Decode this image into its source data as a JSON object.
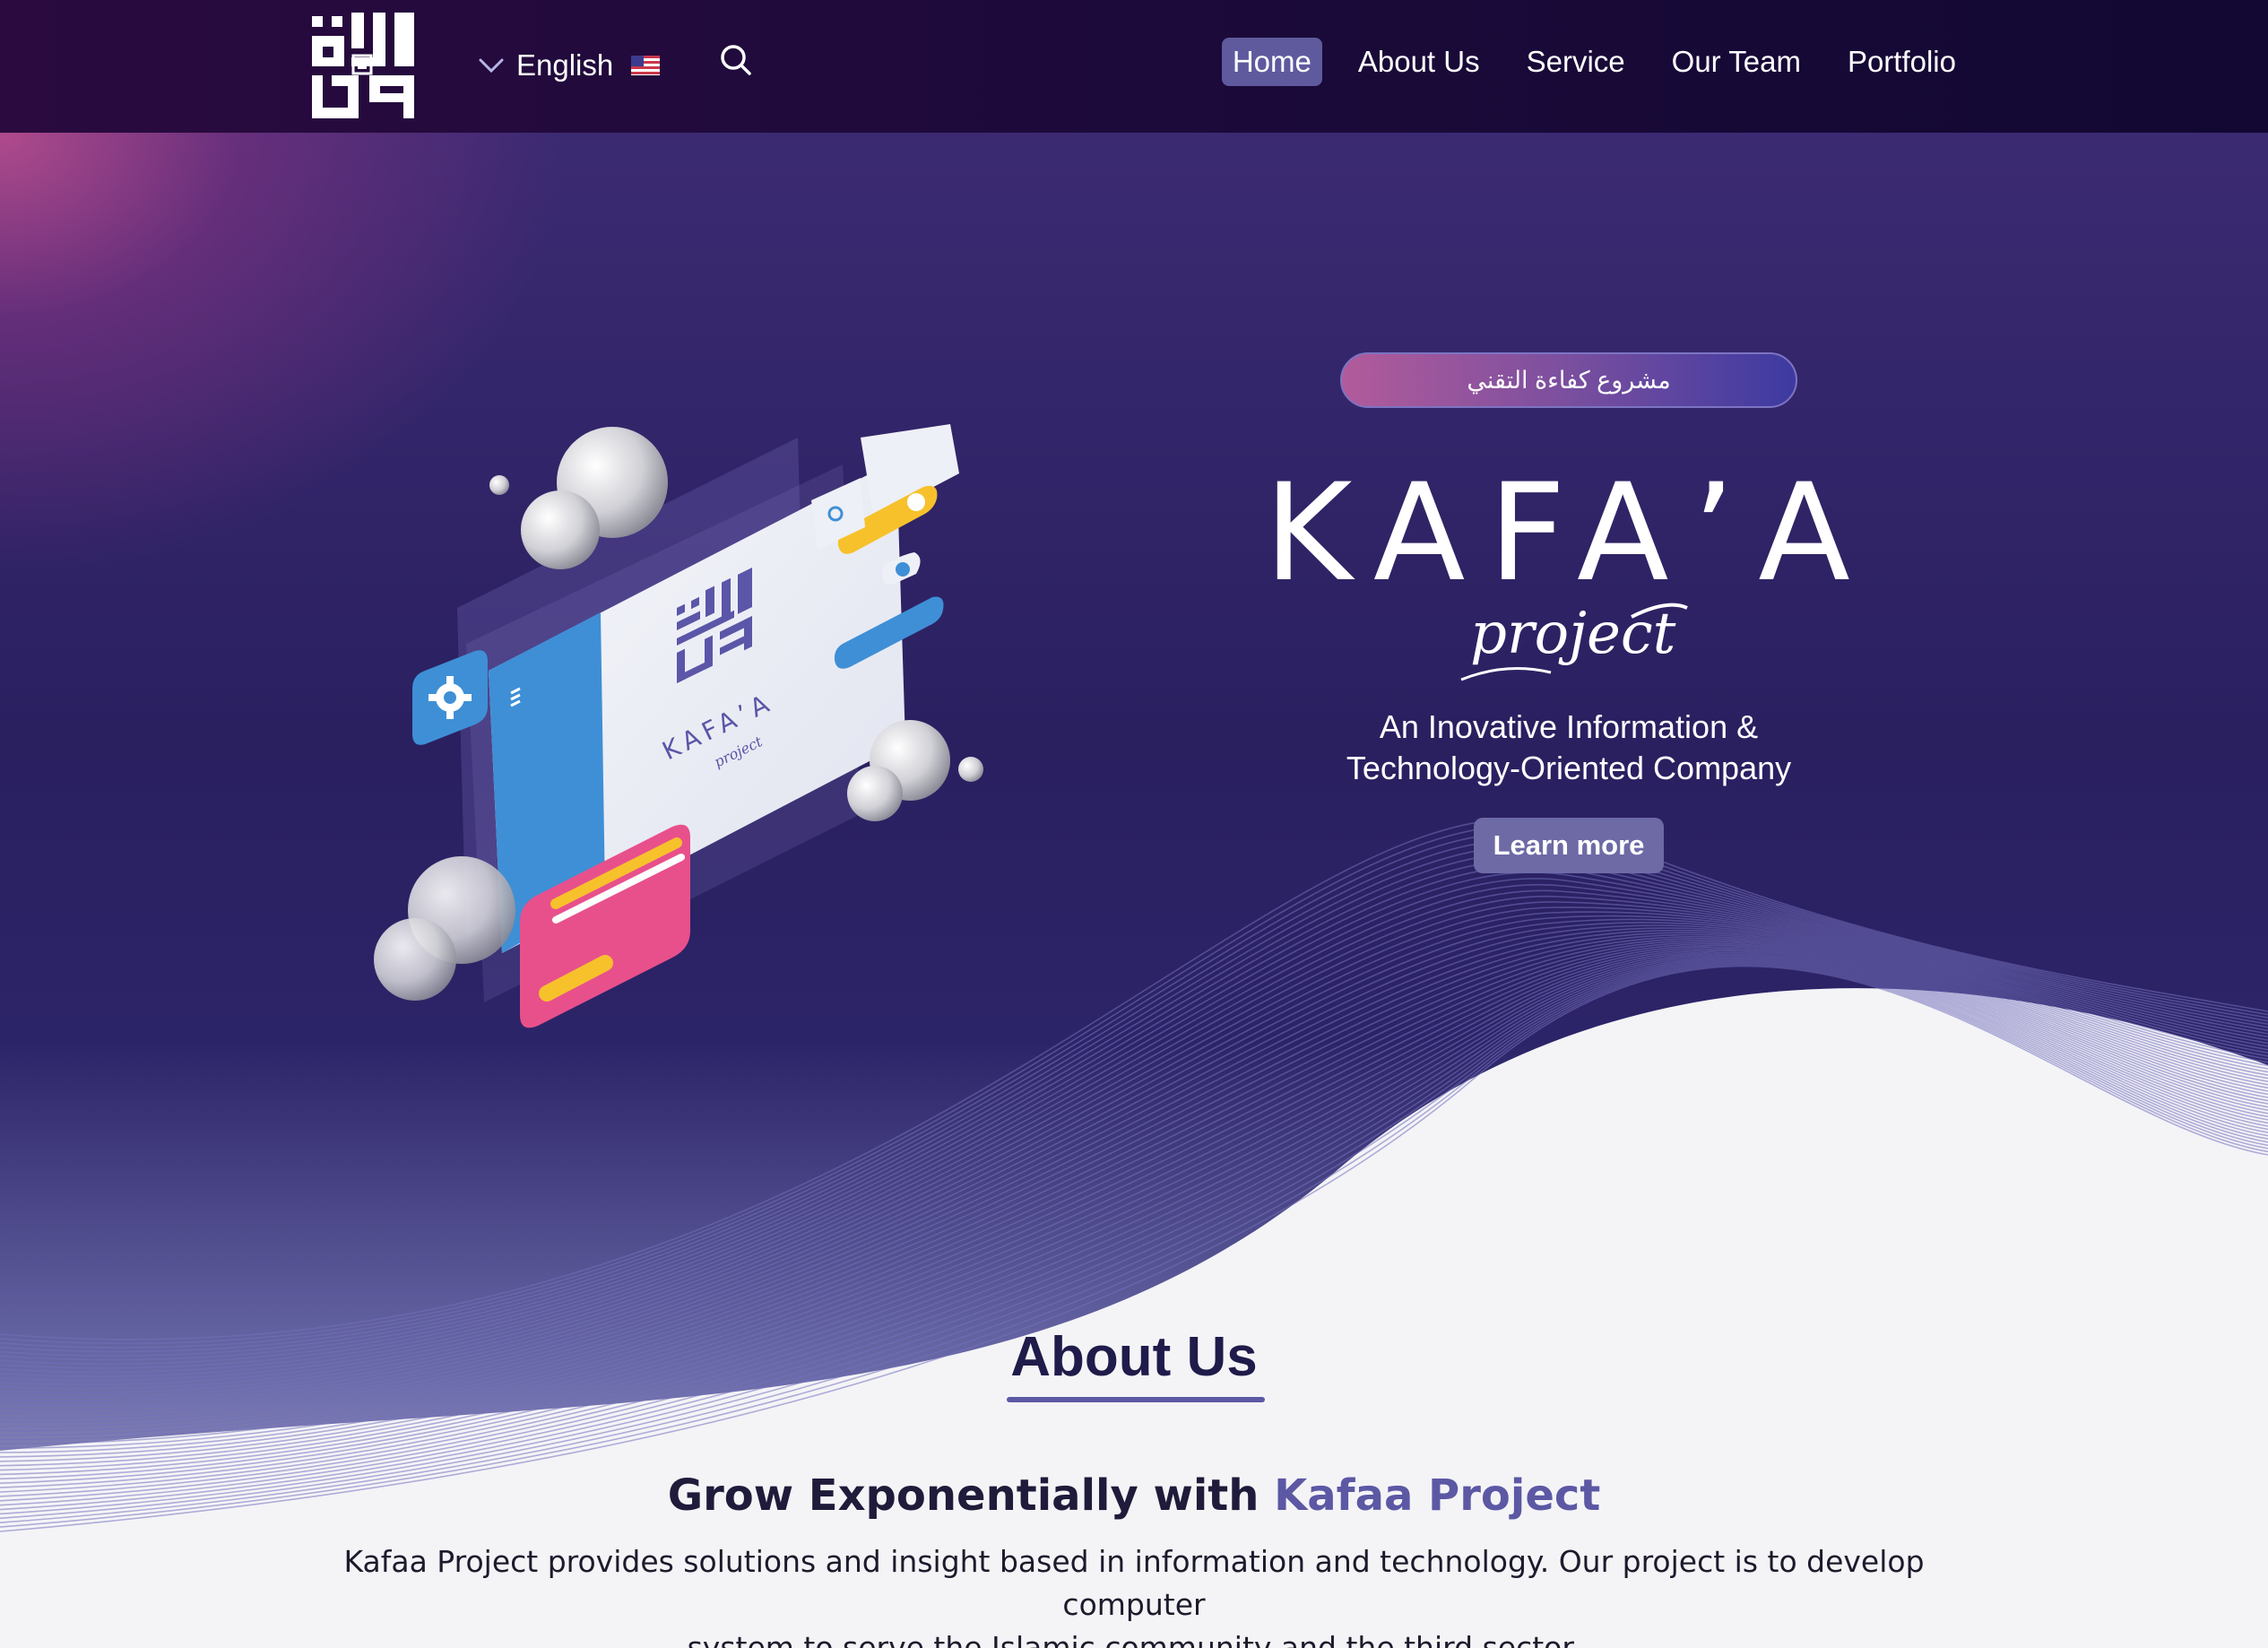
{
  "navbar": {
    "language": "English",
    "links": [
      {
        "label": "Home",
        "active": true
      },
      {
        "label": "About Us"
      },
      {
        "label": "Service"
      },
      {
        "label": "Our Team"
      },
      {
        "label": "Portfolio"
      }
    ]
  },
  "hero": {
    "pill_text": "مشروع كفاءة التقني",
    "brand": "KAFA’A",
    "script": "project",
    "tagline_line1": "An Inovative Information &",
    "tagline_line2": "Technology-Oriented Company",
    "cta": "Learn more",
    "illustration_brand": "KAFA’A",
    "illustration_script": "project"
  },
  "about": {
    "title": "About Us",
    "subtitle_prefix": "Grow Exponentially with ",
    "subtitle_accent": "Kafaa Project",
    "text_line1": "Kafaa Project provides solutions and insight based in information and technology. Our project is to develop computer",
    "text_line2": "system to serve the Islamic community and the third sector."
  },
  "colors": {
    "nav_bg": "#1c0a3a",
    "active_tab": "#5f5a9e",
    "accent": "#5c58a4",
    "pink": "#e8508c",
    "yellow": "#f7c12c",
    "blue": "#3f8fd6"
  },
  "icons": [
    "logo-icon",
    "chevron-down-icon",
    "us-flag-icon",
    "search-icon",
    "gear-icon"
  ]
}
